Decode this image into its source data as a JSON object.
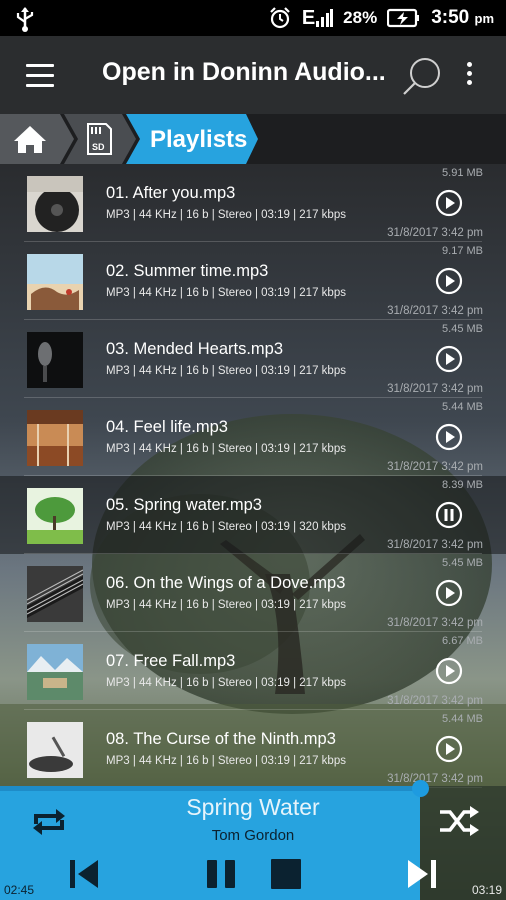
{
  "status": {
    "battery": "28%",
    "time": "3:50",
    "ampm": "pm",
    "network": "E"
  },
  "appbar": {
    "title": "Open in Doninn Audio..."
  },
  "breadcrumb": {
    "current": "Playlists"
  },
  "tracks": [
    {
      "name": "01. After you.mp3",
      "meta": "MP3 | 44 KHz | 16 b | Stereo | 03:19 | 217 kbps",
      "size": "5.91 MB",
      "date": "31/8/2017 3:42 pm",
      "playing": false
    },
    {
      "name": "02. Summer time.mp3",
      "meta": "MP3 | 44 KHz | 16 b | Stereo | 03:19 | 217 kbps",
      "size": "9.17 MB",
      "date": "31/8/2017 3:42 pm",
      "playing": false
    },
    {
      "name": "03. Mended Hearts.mp3",
      "meta": "MP3 | 44 KHz | 16 b | Stereo | 03:19 | 217 kbps",
      "size": "5.45 MB",
      "date": "31/8/2017 3:42 pm",
      "playing": false
    },
    {
      "name": "04. Feel life.mp3",
      "meta": "MP3 | 44 KHz | 16 b | Stereo | 03:19 | 217 kbps",
      "size": "5.44 MB",
      "date": "31/8/2017 3:42 pm",
      "playing": false
    },
    {
      "name": "05. Spring water.mp3",
      "meta": "MP3 | 44 KHz | 16 b | Stereo | 03:19 | 320 kbps",
      "size": "8.39 MB",
      "date": "31/8/2017 3:42 pm",
      "playing": true
    },
    {
      "name": "06. On the Wings of a Dove.mp3",
      "meta": "MP3 | 44 KHz | 16 b | Stereo | 03:19 | 217 kbps",
      "size": "5.45 MB",
      "date": "31/8/2017 3:42 pm",
      "playing": false
    },
    {
      "name": "07. Free Fall.mp3",
      "meta": "MP3 | 44 KHz | 16 b | Stereo | 03:19 | 217 kbps",
      "size": "6.67 MB",
      "date": "31/8/2017 3:42 pm",
      "playing": false
    },
    {
      "name": "08. The Curse of the Ninth.mp3",
      "meta": "MP3 | 44 KHz | 16 b | Stereo | 03:19 | 217 kbps",
      "size": "5.44 MB",
      "date": "31/8/2017 3:42 pm",
      "playing": false
    }
  ],
  "player": {
    "title": "Spring Water",
    "artist": "Tom Gordon",
    "elapsed": "02:45",
    "duration": "03:19",
    "progress_fraction": 0.83
  },
  "colors": {
    "accent": "#27a3df",
    "appbar": "#2b2d2f",
    "statusbar": "#000000"
  }
}
